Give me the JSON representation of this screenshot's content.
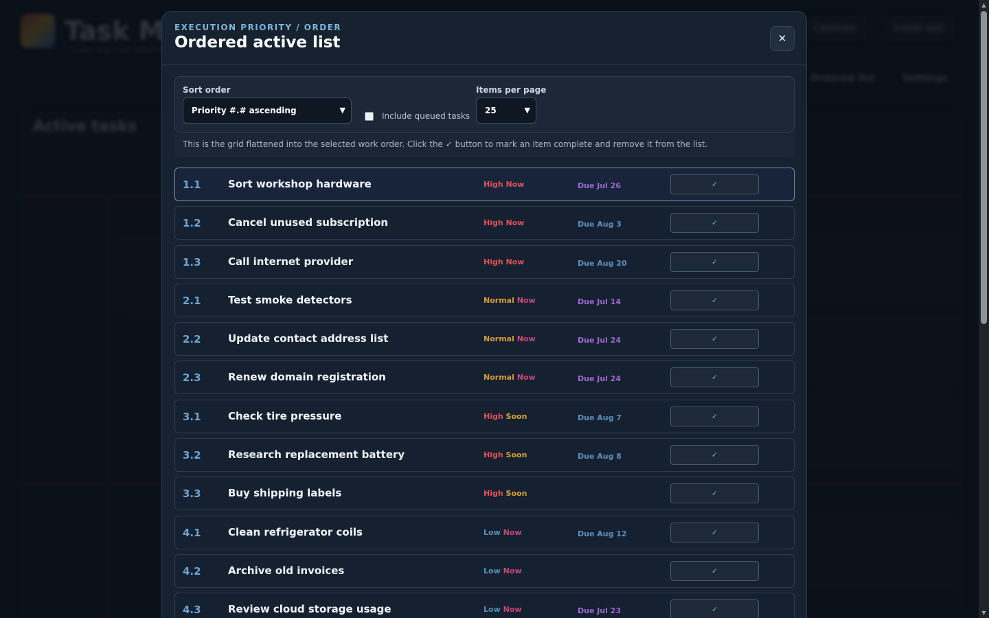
{
  "background": {
    "app_title": "Task Ma",
    "app_subtitle": "Create and track priorities",
    "top_buttons": [
      "Calendar",
      "Install app"
    ],
    "nav_right": [
      "Ordered list",
      "Settings"
    ],
    "panel_title": "Active tasks"
  },
  "modal": {
    "eyebrow": "EXECUTION PRIORITY / ORDER",
    "title": "Ordered active list",
    "close_glyph": "✕"
  },
  "controls": {
    "sort_label": "Sort order",
    "sort_value": "Priority #.# ascending",
    "include_queued_label": "Include queued tasks",
    "include_queued_checked": false,
    "per_page_label": "Items per page",
    "per_page_value": "25",
    "hint": "This is the grid flattened into the selected work order. Click the ✓ button to mark an item complete and remove it from the list."
  },
  "colors": {
    "high": "#e0525a",
    "normal": "#d89a3c",
    "low": "#5b8fbf",
    "now": "#c8487a",
    "soon": "#d6a13a",
    "now_low": "#e0525a",
    "due_purple": "#9d6ad0",
    "due_blue": "#5b8fbf",
    "check": "#5ec58a"
  },
  "tasks": [
    {
      "num": "1.1",
      "name": "Sort workshop hardware",
      "level": "High",
      "when": "Now",
      "due": "Due Jul 26",
      "due_tone": "purple",
      "active": true
    },
    {
      "num": "1.2",
      "name": "Cancel unused subscription",
      "level": "High",
      "when": "Now",
      "due": "Due Aug 3",
      "due_tone": "blue"
    },
    {
      "num": "1.3",
      "name": "Call internet provider",
      "level": "High",
      "when": "Now",
      "due": "Due Aug 20",
      "due_tone": "blue"
    },
    {
      "num": "2.1",
      "name": "Test smoke detectors",
      "level": "Normal",
      "when": "Now",
      "due": "Due Jul 14",
      "due_tone": "purple"
    },
    {
      "num": "2.2",
      "name": "Update contact address list",
      "level": "Normal",
      "when": "Now",
      "due": "Due Jul 24",
      "due_tone": "purple"
    },
    {
      "num": "2.3",
      "name": "Renew domain registration",
      "level": "Normal",
      "when": "Now",
      "due": "Due Jul 24",
      "due_tone": "purple"
    },
    {
      "num": "3.1",
      "name": "Check tire pressure",
      "level": "High",
      "when": "Soon",
      "due": "Due Aug 7",
      "due_tone": "blue"
    },
    {
      "num": "3.2",
      "name": "Research replacement battery",
      "level": "High",
      "when": "Soon",
      "due": "Due Aug 8",
      "due_tone": "blue"
    },
    {
      "num": "3.3",
      "name": "Buy shipping labels",
      "level": "High",
      "when": "Soon",
      "due": "",
      "due_tone": "blue"
    },
    {
      "num": "4.1",
      "name": "Clean refrigerator coils",
      "level": "Low",
      "when": "Now",
      "due": "Due Aug 12",
      "due_tone": "blue"
    },
    {
      "num": "4.2",
      "name": "Archive old invoices",
      "level": "Low",
      "when": "Now",
      "due": "",
      "due_tone": "blue"
    },
    {
      "num": "4.3",
      "name": "Review cloud storage usage",
      "level": "Low",
      "when": "Now",
      "due": "Due Jul 23",
      "due_tone": "purple"
    }
  ],
  "complete_glyph": "✓"
}
